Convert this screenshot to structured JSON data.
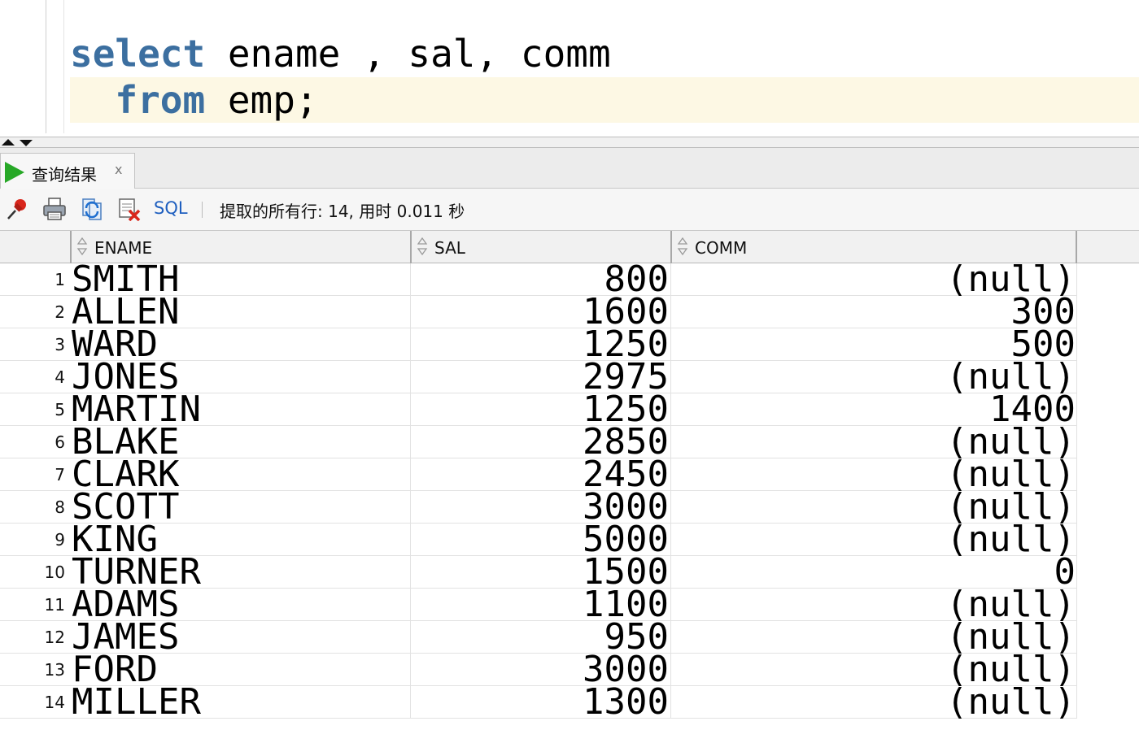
{
  "editor": {
    "line1": {
      "keyword": "select",
      "rest": " ename , sal, comm"
    },
    "line2": {
      "indent": "  ",
      "keyword": "from",
      "rest": " emp;"
    },
    "keyword_color": "#3c6fa0",
    "current_line_color": "#fdf8e4"
  },
  "results_tab": {
    "icon": "run-triangle-icon",
    "label": "查询结果",
    "close_label": "x"
  },
  "toolbar": {
    "icons": [
      "pin-icon",
      "print-icon",
      "refresh-icon",
      "clear-icon"
    ],
    "sql_label": "SQL",
    "status": "提取的所有行: 14, 用时 0.011 秒"
  },
  "grid": {
    "columns": [
      "ENAME",
      "SAL",
      "COMM"
    ],
    "rows": [
      {
        "n": "1",
        "ename": "SMITH",
        "sal": "800",
        "comm": "(null)"
      },
      {
        "n": "2",
        "ename": "ALLEN",
        "sal": "1600",
        "comm": "300"
      },
      {
        "n": "3",
        "ename": "WARD",
        "sal": "1250",
        "comm": "500"
      },
      {
        "n": "4",
        "ename": "JONES",
        "sal": "2975",
        "comm": "(null)"
      },
      {
        "n": "5",
        "ename": "MARTIN",
        "sal": "1250",
        "comm": "1400"
      },
      {
        "n": "6",
        "ename": "BLAKE",
        "sal": "2850",
        "comm": "(null)"
      },
      {
        "n": "7",
        "ename": "CLARK",
        "sal": "2450",
        "comm": "(null)"
      },
      {
        "n": "8",
        "ename": "SCOTT",
        "sal": "3000",
        "comm": "(null)"
      },
      {
        "n": "9",
        "ename": "KING",
        "sal": "5000",
        "comm": "(null)"
      },
      {
        "n": "10",
        "ename": "TURNER",
        "sal": "1500",
        "comm": "0"
      },
      {
        "n": "11",
        "ename": "ADAMS",
        "sal": "1100",
        "comm": "(null)"
      },
      {
        "n": "12",
        "ename": "JAMES",
        "sal": "950",
        "comm": "(null)"
      },
      {
        "n": "13",
        "ename": "FORD",
        "sal": "3000",
        "comm": "(null)"
      },
      {
        "n": "14",
        "ename": "MILLER",
        "sal": "1300",
        "comm": "(null)"
      }
    ]
  }
}
